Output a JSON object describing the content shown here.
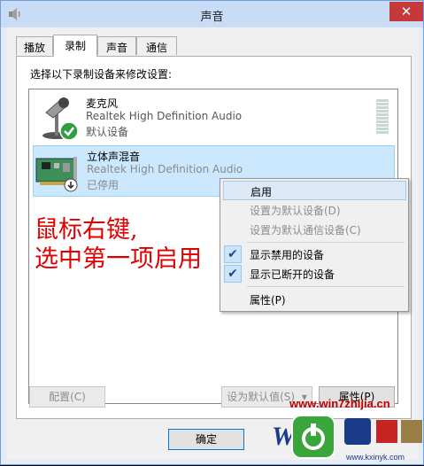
{
  "window": {
    "title": "声音",
    "close_glyph": "✕"
  },
  "tabs": [
    {
      "label": "播放",
      "active": false
    },
    {
      "label": "录制",
      "active": true
    },
    {
      "label": "声音",
      "active": false
    },
    {
      "label": "通信",
      "active": false
    }
  ],
  "panel": {
    "instruction": "选择以下录制设备来修改设置:"
  },
  "devices": [
    {
      "name": "麦克风",
      "description": "Realtek High Definition Audio",
      "status": "默认设备",
      "icon": "microphone-icon",
      "badge": "default-check-icon",
      "selected": false,
      "level_bars": 10
    },
    {
      "name": "立体声混音",
      "description": "Realtek High Definition Audio",
      "status": "已停用",
      "icon": "sound-card-icon",
      "badge": "disabled-arrow-icon",
      "selected": true
    }
  ],
  "overlay_annotation": {
    "line1": "鼠标右键,",
    "line2": "选中第一项启用",
    "color": "#e00000"
  },
  "context_menu": {
    "items": [
      {
        "label": "启用",
        "enabled": true,
        "highlighted": true,
        "checked": false
      },
      {
        "label": "设置为默认设备(D)",
        "enabled": false,
        "checked": false
      },
      {
        "label": "设置为默认通信设备(C)",
        "enabled": false,
        "checked": false
      },
      {
        "label": "显示禁用的设备",
        "enabled": true,
        "checked": true
      },
      {
        "label": "显示已断开的设备",
        "enabled": true,
        "checked": true
      },
      {
        "label": "属性(P)",
        "enabled": true,
        "checked": false
      }
    ],
    "check_glyph": "✔"
  },
  "buttons": {
    "configure": "配置(C)",
    "set_default": "设为默认值(S)",
    "set_default_arrow": "▾",
    "properties": "属性(P)",
    "ok": "确定"
  },
  "watermark": {
    "site": "www.win7zhijia.cn",
    "url": "www.kxinyk.com"
  },
  "colors": {
    "accent": "#0078d7",
    "selection": "#cce8ff",
    "close_button": "#c7383b",
    "check_green": "#2ea043"
  }
}
